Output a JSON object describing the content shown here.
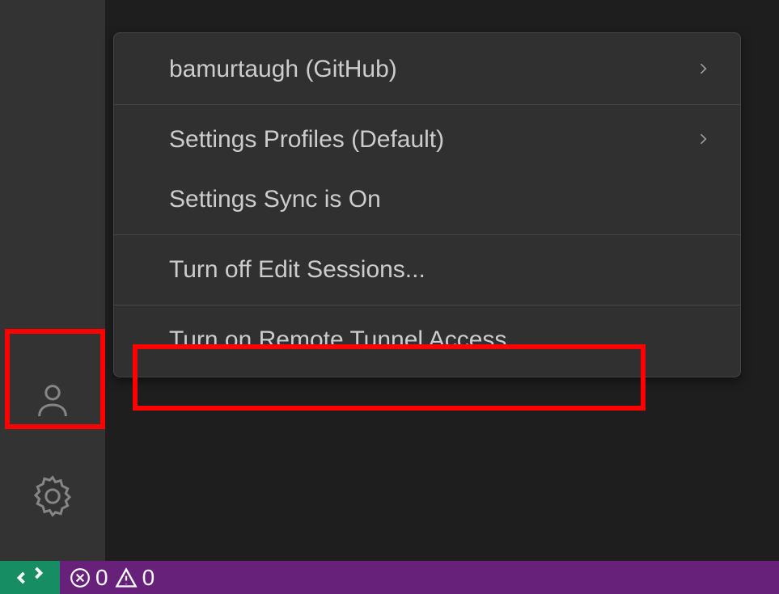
{
  "menu": {
    "account": "bamurtaugh (GitHub)",
    "profiles": "Settings Profiles (Default)",
    "sync": "Settings Sync is On",
    "editSessions": "Turn off Edit Sessions...",
    "remoteTunnel": "Turn on Remote Tunnel Access..."
  },
  "statusBar": {
    "errors": "0",
    "warnings": "0"
  }
}
